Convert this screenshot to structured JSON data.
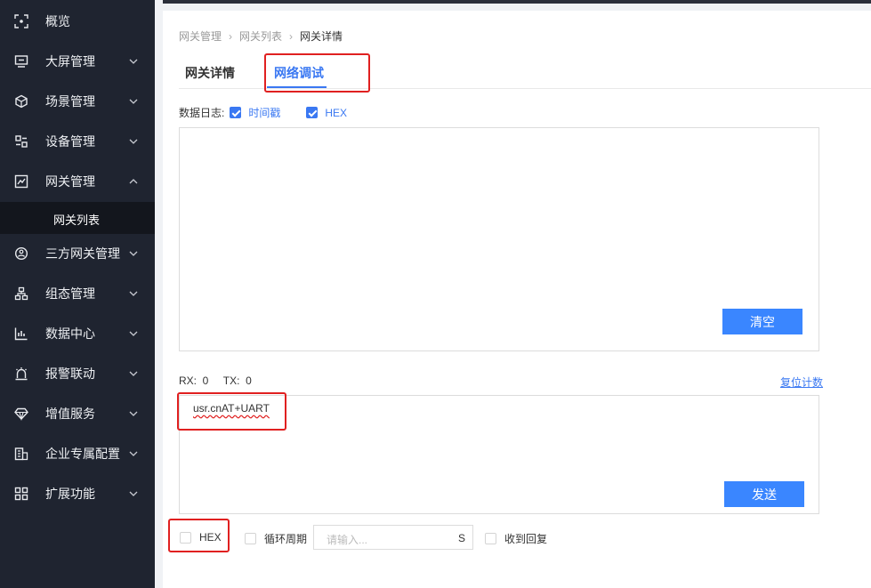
{
  "sidebar": {
    "items": [
      {
        "label": "概览",
        "icon": "overview-icon",
        "has_chevron": false
      },
      {
        "label": "大屏管理",
        "icon": "monitor-icon",
        "has_chevron": true
      },
      {
        "label": "场景管理",
        "icon": "cube-icon",
        "has_chevron": true
      },
      {
        "label": "设备管理",
        "icon": "device-icon",
        "has_chevron": true
      },
      {
        "label": "网关管理",
        "icon": "gateway-icon",
        "has_chevron": true,
        "expanded": true
      },
      {
        "label": "三方网关管理",
        "icon": "third-party-icon",
        "has_chevron": true
      },
      {
        "label": "组态管理",
        "icon": "hierarchy-icon",
        "has_chevron": true
      },
      {
        "label": "数据中心",
        "icon": "bar-chart-icon",
        "has_chevron": true
      },
      {
        "label": "报警联动",
        "icon": "alarm-icon",
        "has_chevron": true
      },
      {
        "label": "增值服务",
        "icon": "diamond-icon",
        "has_chevron": true
      },
      {
        "label": "企业专属配置",
        "icon": "enterprise-icon",
        "has_chevron": true
      },
      {
        "label": "扩展功能",
        "icon": "grid-icon",
        "has_chevron": true
      }
    ],
    "sub_item": {
      "label": "网关列表"
    }
  },
  "breadcrumb": {
    "items": [
      "网关管理",
      "网关列表",
      "网关详情"
    ]
  },
  "tabs": [
    {
      "label": "网关详情",
      "active": false
    },
    {
      "label": "网络调试",
      "active": true
    }
  ],
  "log": {
    "label": "数据日志:",
    "timestamp_label": "时间戳",
    "timestamp_checked": true,
    "hex_label": "HEX",
    "hex_checked": true,
    "clear_button": "清空"
  },
  "counters": {
    "text": "RX:  0     TX:  0",
    "reset_link": "复位计数"
  },
  "send": {
    "value": "usr.cnAT+UART",
    "send_button": "发送"
  },
  "options": {
    "hex_label": "HEX",
    "hex_checked": false,
    "cycle_label": "循环周期",
    "cycle_checked": false,
    "period_placeholder": "请输入...",
    "period_unit": "S",
    "reply_label": "收到回复",
    "reply_checked": false
  },
  "colors": {
    "sidebar_bg": "#1f2430",
    "accent": "#3a78f2",
    "button": "#3a86ff",
    "highlight": "#e02020"
  }
}
